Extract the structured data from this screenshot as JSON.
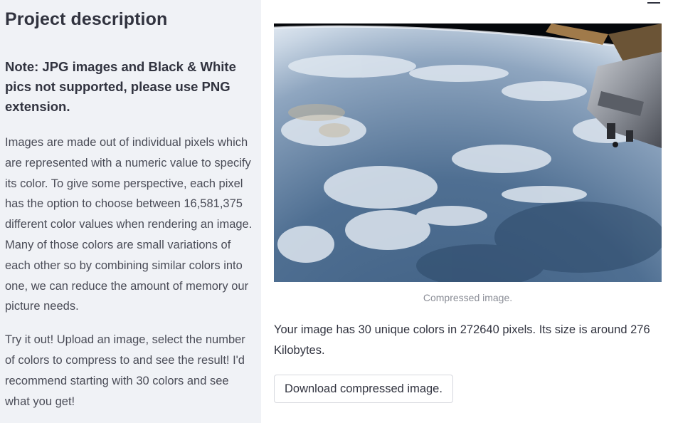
{
  "sidebar": {
    "title": "Project description",
    "note": "Note: JPG images and Black & White pics not supported, please use PNG extension.",
    "paragraph1": "Images are made out of individual pixels which are represented with a numeric value to specify its color. To give some perspective, each pixel has the option to choose between 16,581,375 different color values when rendering an image. Many of those colors are small variations of each other so by combining similar colors into one, we can reduce the amount of memory our picture needs.",
    "paragraph2": "Try it out! Upload an image, select the number of colors to compress to and see the result! I'd recommend starting with 30 colors and see what you get!"
  },
  "main": {
    "image_caption": "Compressed image.",
    "info_text": "Your image has 30 unique colors in 272640 pixels. Its size is around 276 Kilobytes.",
    "download_label": "Download compressed image."
  },
  "icons": {
    "menu": "hamburger-menu-icon"
  }
}
